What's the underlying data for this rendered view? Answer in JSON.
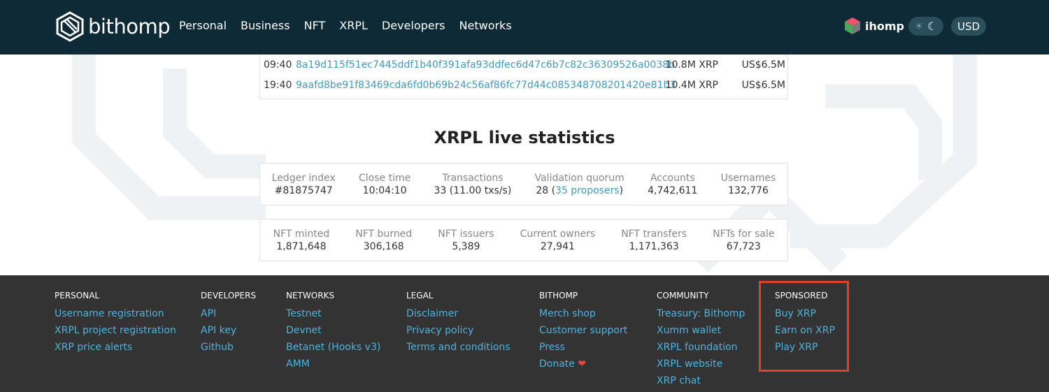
{
  "header": {
    "logo_text": "bithomp",
    "nav": [
      "Personal",
      "Business",
      "NFT",
      "XRPL",
      "Developers",
      "Networks"
    ],
    "user_name": "ihomp",
    "currency": "USD"
  },
  "transactions": [
    {
      "time": "09:40",
      "hash": "8a19d115f51ec7445ddf1b40f391afa93ddfec6d47c6b7c82c36309526a0038b",
      "amount": "10.8M XRP",
      "usd": "US$6.5M"
    },
    {
      "time": "19:40",
      "hash": "9aafd8be91f83469cda6fd0b69b24c56af86fc77d44c085348708201420e81b3",
      "amount": "10.4M XRP",
      "usd": "US$6.5M"
    }
  ],
  "stats_title": "XRPL live statistics",
  "stats1": [
    {
      "label": "Ledger index",
      "value": "#81875747",
      "link": true
    },
    {
      "label": "Close time",
      "value": "10:04:10"
    },
    {
      "label": "Transactions",
      "value": "33 (11.00 txs/s)"
    },
    {
      "label": "Validation quorum",
      "value_prefix": "28 (",
      "value_link": "35 proposers",
      "value_suffix": ")"
    },
    {
      "label": "Accounts",
      "value": "4,742,611"
    },
    {
      "label": "Usernames",
      "value": "132,776"
    }
  ],
  "stats2": [
    {
      "label": "NFT minted",
      "value": "1,871,648"
    },
    {
      "label": "NFT burned",
      "value": "306,168"
    },
    {
      "label": "NFT issuers",
      "value": "5,389",
      "link": true
    },
    {
      "label": "Current owners",
      "value": "27,941"
    },
    {
      "label": "NFT transfers",
      "value": "1,171,363"
    },
    {
      "label": "NFTs for sale",
      "value": "67,723"
    }
  ],
  "footer": {
    "personal": {
      "title": "PERSONAL",
      "items": [
        "Username registration",
        "XRPL project registration",
        "XRP price alerts"
      ]
    },
    "developers": {
      "title": "DEVELOPERS",
      "items": [
        "API",
        "API key",
        "Github"
      ]
    },
    "networks": {
      "title": "NETWORKS",
      "items": [
        "Testnet",
        "Devnet",
        "Betanet (Hooks v3)",
        "AMM"
      ]
    },
    "legal": {
      "title": "LEGAL",
      "items": [
        "Disclaimer",
        "Privacy policy",
        "Terms and conditions"
      ]
    },
    "bithomp": {
      "title": "BITHOMP",
      "items": [
        "Merch shop",
        "Customer support",
        "Press",
        "Donate"
      ]
    },
    "community": {
      "title": "COMMUNITY",
      "items": [
        "Treasury: Bithomp",
        "Xumm wallet",
        "XRPL foundation",
        "XRPL website",
        "XRP chat"
      ]
    },
    "sponsored": {
      "title": "SPONSORED",
      "items": [
        "Buy XRP",
        "Earn on XRP",
        "Play XRP"
      ]
    }
  },
  "colors": {
    "header_bg": "#0e2a36",
    "link": "#3e9cc4",
    "footer_bg": "#333333",
    "footer_link": "#4fb3dd",
    "highlight": "#e0402b"
  }
}
